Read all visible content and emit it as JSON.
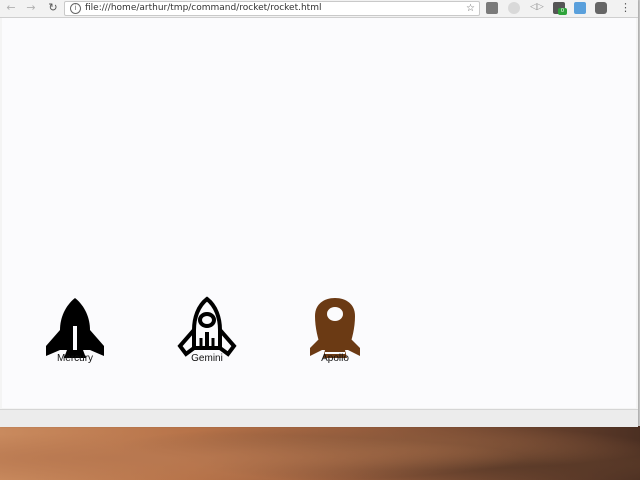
{
  "browser": {
    "url": "file:///home/arthur/tmp/command/rocket/rocket.html",
    "nav": {
      "back": "←",
      "forward": "→",
      "reload": "↻"
    },
    "icons": [
      "info-icon",
      "star-icon",
      "extension-icons",
      "menu-icon"
    ]
  },
  "page": {
    "rockets": [
      {
        "label": "Mercury",
        "color": "#000000"
      },
      {
        "label": "Gemini",
        "color": "#000000"
      },
      {
        "label": "Apollo",
        "color": "#6b3a14"
      }
    ]
  },
  "extensions": {
    "badge_text": "0"
  }
}
